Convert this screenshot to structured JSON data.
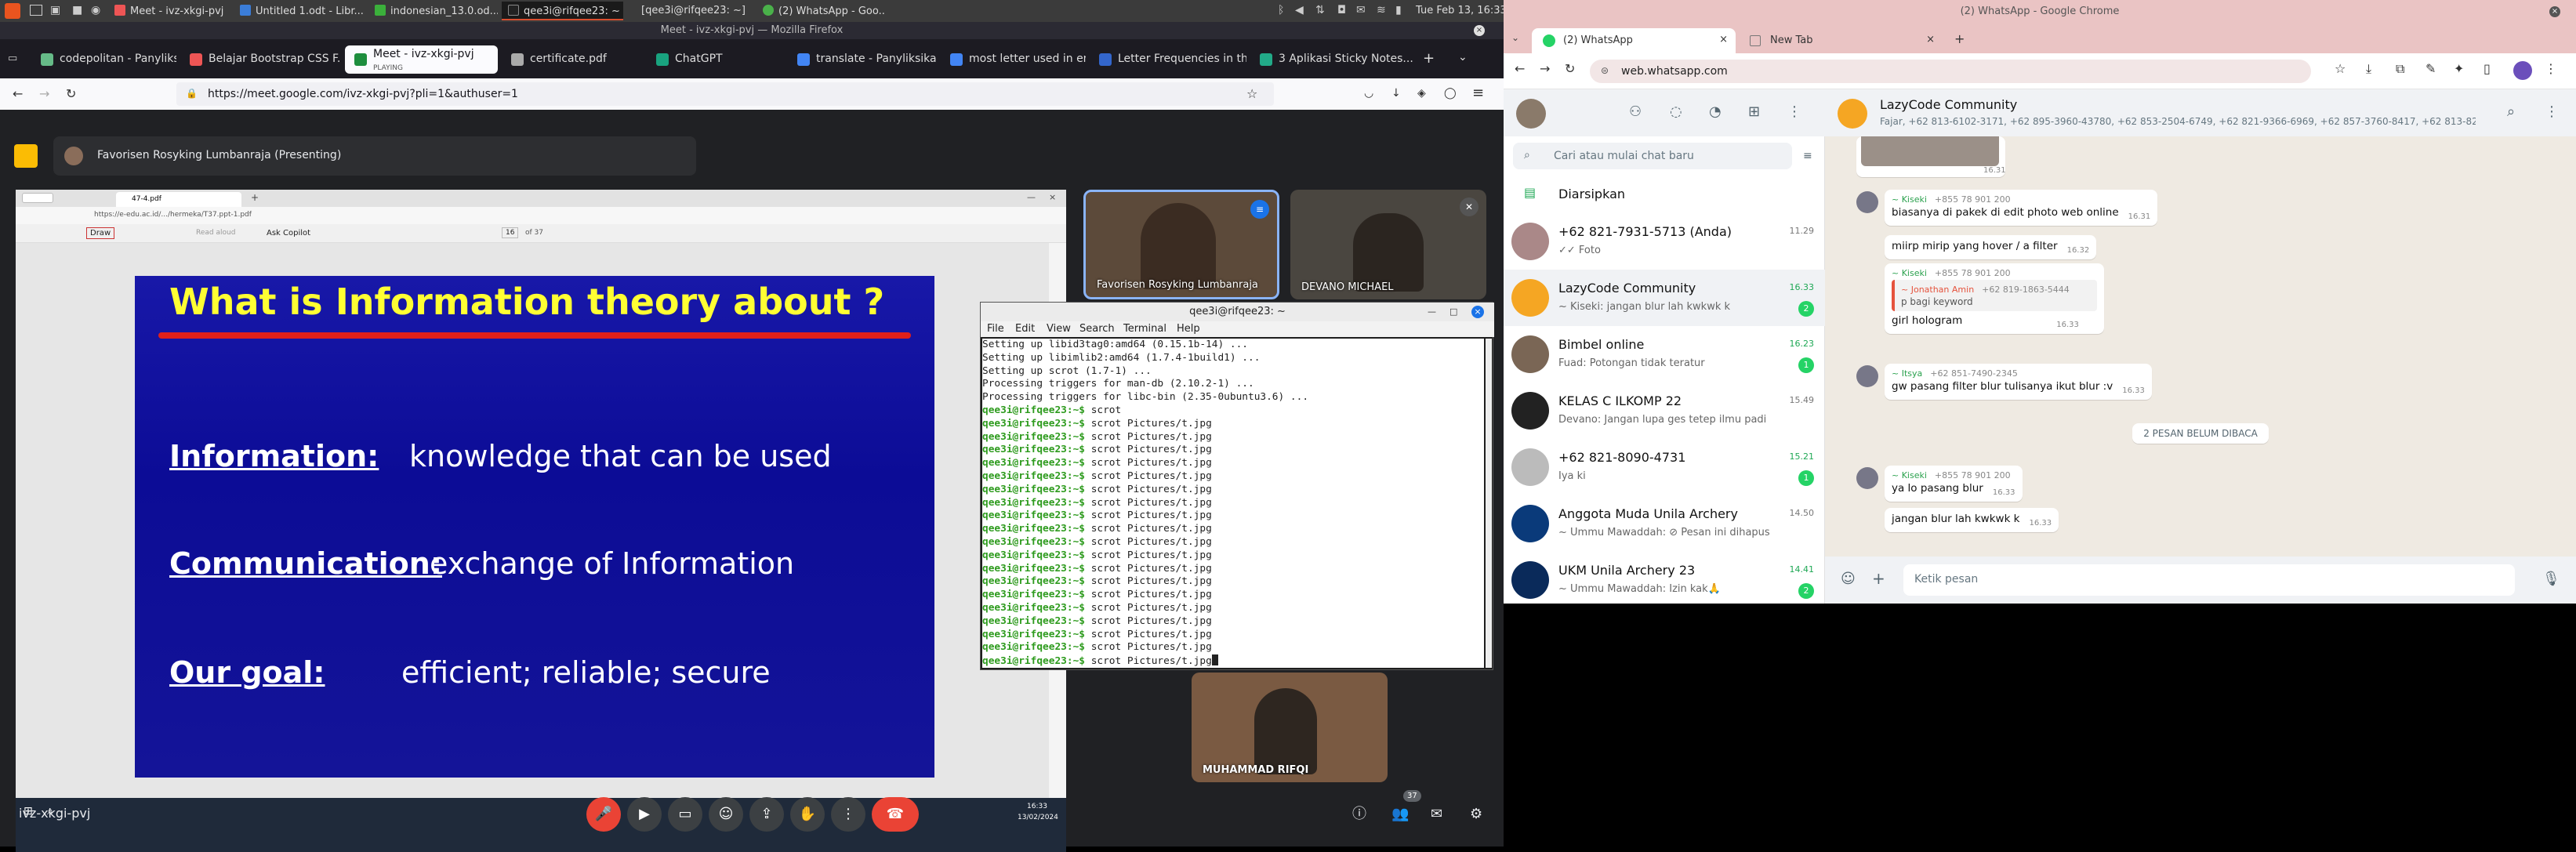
{
  "top_panel": {
    "apps": [
      "Meet - ivz-xkgi-pvj",
      "Untitled 1.odt - Libr...",
      "indonesian_13.0.od...",
      "qee3i@rifqee23: ~",
      "[qee3i@rifqee23: ~]",
      "(2) WhatsApp - Goo..."
    ],
    "clock": "Tue Feb 13, 16:33"
  },
  "firefox": {
    "window_title": "Meet - ivz-xkgi-pvj — Mozilla Firefox",
    "tabs": [
      {
        "label": "codepolitan - Panyliksik..."
      },
      {
        "label": "Belajar Bootstrap CSS F..."
      },
      {
        "label": "Meet - ivz-xkgi-pvj",
        "sub": "PLAYING"
      },
      {
        "label": "certificate.pdf"
      },
      {
        "label": "ChatGPT"
      },
      {
        "label": "translate - Panyliksikan..."
      },
      {
        "label": "most letter used in eng..."
      },
      {
        "label": "Letter Frequencies in th..."
      },
      {
        "label": "3 Aplikasi Sticky Notes..."
      }
    ],
    "url": "https://meet.google.com/ivz-xkgi-pvj?pli=1&authuser=1"
  },
  "meet": {
    "presenter_label": "Favorisen Rosyking Lumbanraja (Presenting)",
    "meeting_code": "ivz-xkgi-pvj",
    "participants_count": "37",
    "participants": [
      "Favorisen Rosyking Lumbanraja",
      "DEVANO MICHAEL",
      "MUHAMMAD RIFQI"
    ],
    "shared_browser": {
      "tab": "47-4.pdf",
      "url": "https://e-edu.ac.id/.../hermeka/T37.ppt-1.pdf",
      "toolbar_draw": "Draw",
      "toolbar_read": "Read aloud",
      "toolbar_copilot": "Ask Copilot",
      "page": "16",
      "of": "of 37",
      "taskbar_time": "16:33",
      "taskbar_date": "13/02/2024"
    },
    "slide": {
      "title": "What is Information theory about ?",
      "rows": [
        {
          "label": "Information:",
          "text": "knowledge that can be used"
        },
        {
          "label": "Communication:",
          "text": "exchange of Information"
        },
        {
          "label": "Our goal:",
          "text": "efficient;  reliable;  secure"
        }
      ]
    }
  },
  "terminal": {
    "title": "qee3i@rifqee23: ~",
    "menu": [
      "File",
      "Edit",
      "View",
      "Search",
      "Terminal",
      "Help"
    ],
    "lines": [
      "Setting up libid3tag0:amd64 (0.15.1b-14) ...",
      "Setting up libimlib2:amd64 (1.7.4-1build1) ...",
      "Setting up scrot (1.7-1) ...",
      "Processing triggers for man-db (2.10.2-1) ...",
      "Processing triggers for libc-bin (2.35-0ubuntu3.6) ..."
    ],
    "prompt": "qee3i@rifqee23:~$",
    "commands": [
      "scrot",
      "scrot Pictures/t.jpg",
      "scrot Pictures/t.jpg",
      "scrot Pictures/t.jpg",
      "scrot Pictures/t.jpg",
      "scrot Pictures/t.jpg",
      "scrot Pictures/t.jpg",
      "scrot Pictures/t.jpg",
      "scrot Pictures/t.jpg",
      "scrot Pictures/t.jpg",
      "scrot Pictures/t.jpg",
      "scrot Pictures/t.jpg",
      "scrot Pictures/t.jpg",
      "scrot Pictures/t.jpg",
      "scrot Pictures/t.jpg",
      "scrot Pictures/t.jpg",
      "scrot Pictures/t.jpg",
      "scrot Pictures/t.jpg",
      "scrot Pictures/t.jpg",
      "scrot Pictures/t.jpg"
    ]
  },
  "chrome": {
    "window_title": "(2) WhatsApp - Google Chrome",
    "tabs": [
      "(2) WhatsApp",
      "New Tab"
    ],
    "url": "web.whatsapp.com"
  },
  "whatsapp": {
    "search_placeholder": "Cari atau mulai chat baru",
    "archived": "Diarsipkan",
    "chats": [
      {
        "name": "+62 821-7931-5713 (Anda)",
        "preview": "✓✓ Foto",
        "time": "11.29"
      },
      {
        "name": "LazyCode Community",
        "preview": "~ Kiseki: jangan blur lah kwkwk k",
        "time": "16.33",
        "badge": "2"
      },
      {
        "name": "Bimbel online",
        "preview": "Fuad: Potongan tidak teratur",
        "time": "16.23",
        "badge": "1"
      },
      {
        "name": "KELAS C ILKOMP 22",
        "preview": "Devano: Jangan lupa ges tetep ilmu padi",
        "time": "15.49"
      },
      {
        "name": "+62 821-8090-4731",
        "preview": "Iya ki",
        "time": "15.21",
        "badge": "1"
      },
      {
        "name": "Anggota Muda Unila Archery",
        "preview": "~ Ummu Mawaddah: ⊘ Pesan ini dihapus",
        "time": "14.50"
      },
      {
        "name": "UKM Unila Archery 23",
        "preview": "~ Ummu Mawaddah: Izin kak🙏",
        "time": "14.41",
        "badge": "2"
      }
    ],
    "conversation": {
      "name": "LazyCode Community",
      "members": "Fajar, +62 813-6102-3171, +62 895-3960-43780, +62 853-2504-6749, +62 821-9366-6969, +62 857-3760-8417, +62 813-8228-6...",
      "unread_divider": "2 PESAN BELUM DIBACA",
      "input_placeholder": "Ketik pesan",
      "messages": [
        {
          "time": "16.31"
        },
        {
          "sender": "~ Kiseki",
          "phone": "+855 78 901 200",
          "text": "biasanya di pakek di edit photo web online",
          "time": "16.31"
        },
        {
          "text": "miirp mirip yang hover / a filter",
          "time": "16.32"
        },
        {
          "sender": "~ Kiseki",
          "phone": "+855 78 901 200",
          "quote_sender": "~ Jonathan Amin",
          "quote_phone": "+62 819-1863-5444",
          "quote_text": "p bagi keyword",
          "text": "girl hologram",
          "time": "16.33"
        },
        {
          "sender": "~ Itsya",
          "phone": "+62 851-7490-2345",
          "text": "gw pasang filter blur tulisanya ikut blur :v",
          "time": "16.33"
        },
        {
          "sender": "~ Kiseki",
          "phone": "+855 78 901 200",
          "text": "ya lo pasang blur",
          "time": "16.33"
        },
        {
          "text": "jangan blur lah kwkwk k",
          "time": "16.33"
        }
      ]
    }
  },
  "colors": {
    "accent_whatsapp": "#25d366",
    "end_call": "#ea4335",
    "slide_bg": "#0c0c96",
    "slide_title": "#ffff33",
    "terminal_prompt": "#2e9b1e"
  }
}
